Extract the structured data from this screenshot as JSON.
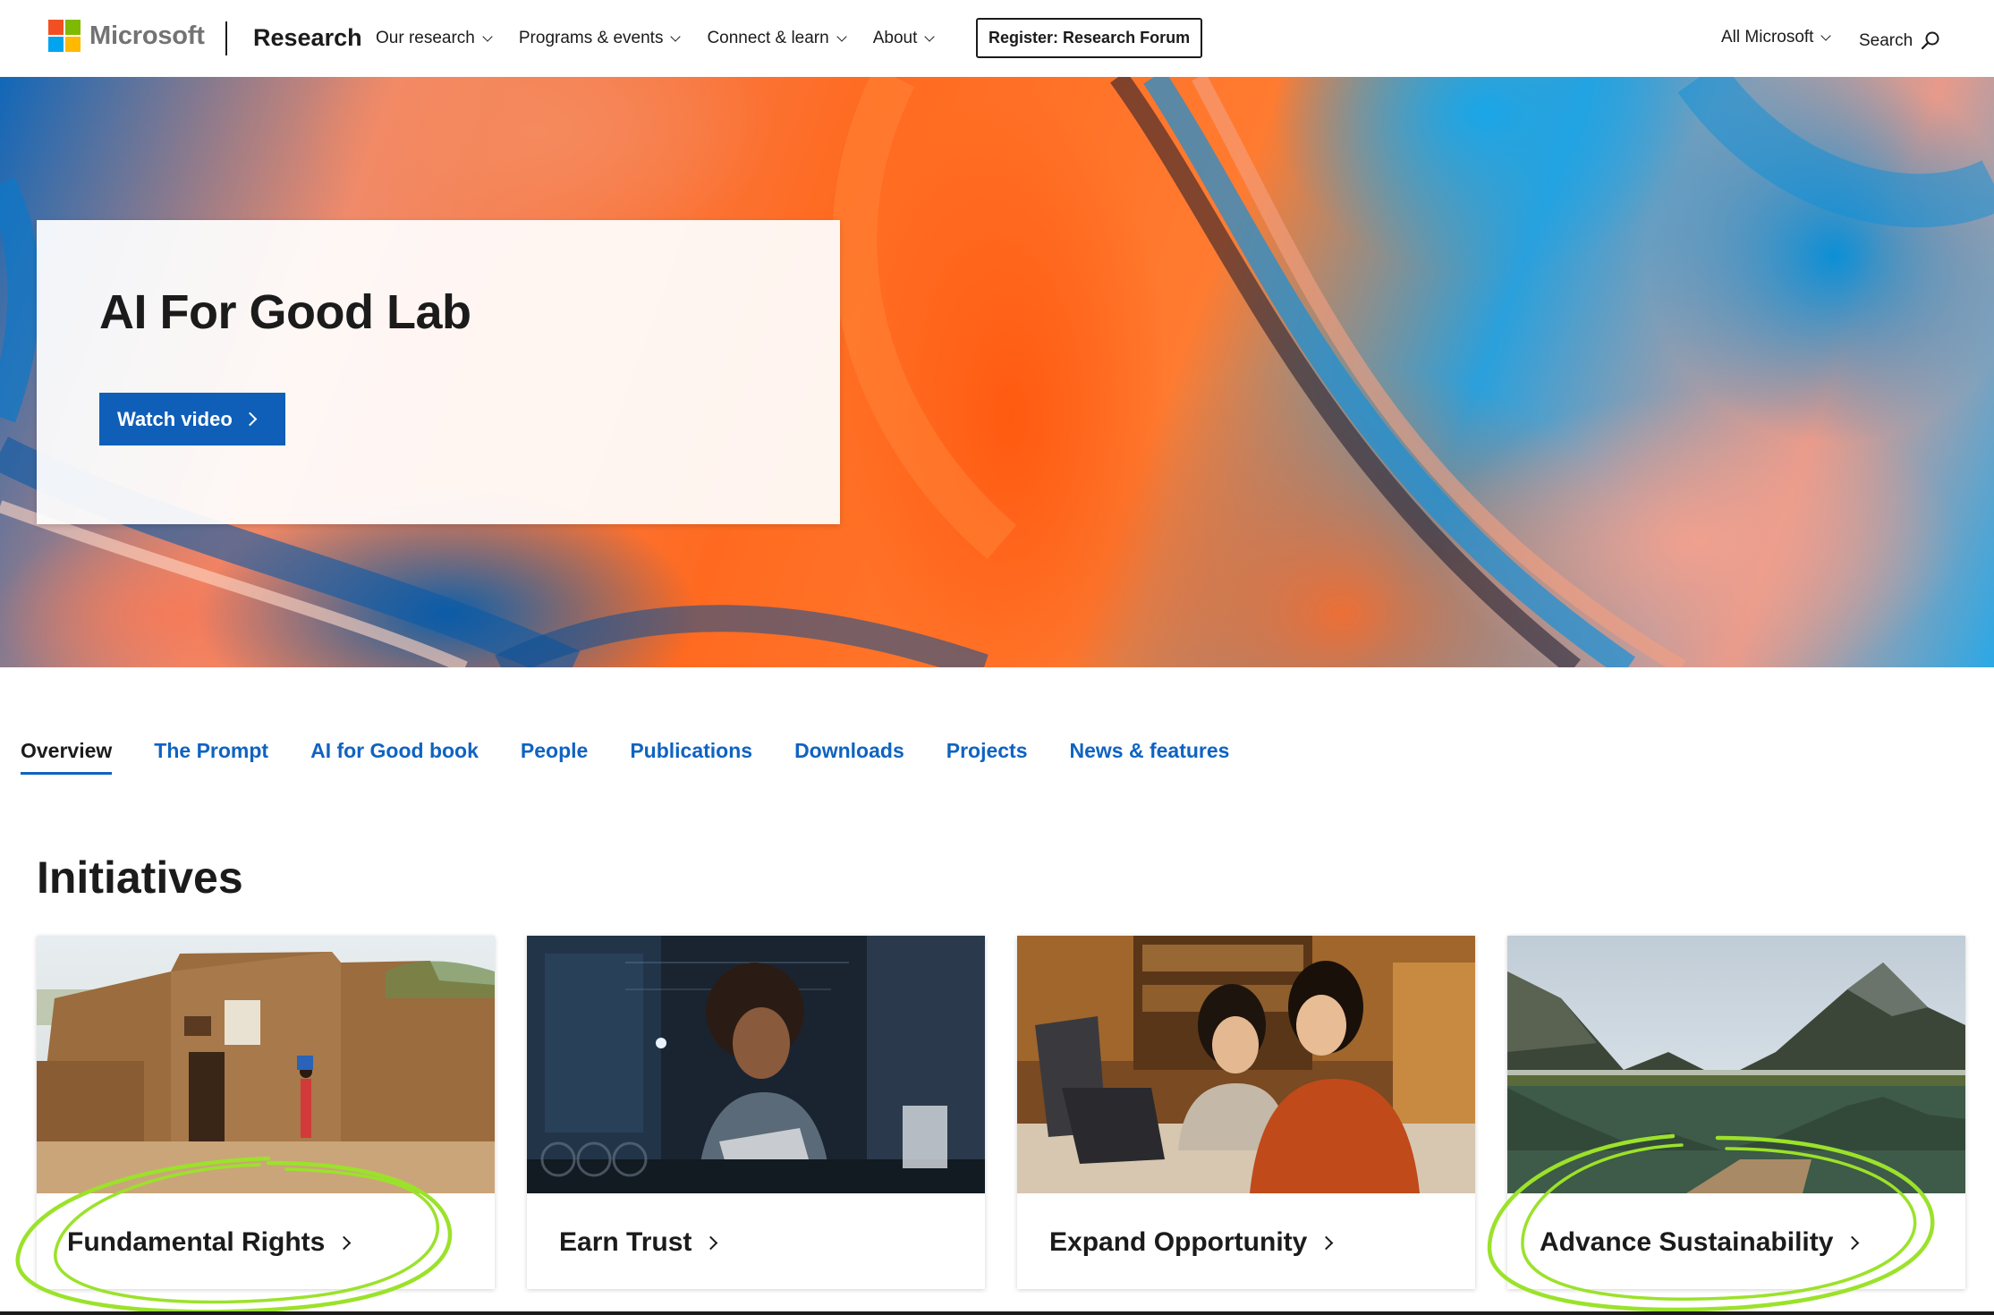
{
  "header": {
    "brand": "Microsoft",
    "section": "Research",
    "nav": [
      {
        "label": "Our research"
      },
      {
        "label": "Programs & events"
      },
      {
        "label": "Connect & learn"
      },
      {
        "label": "About"
      }
    ],
    "register_label": "Register: Research Forum",
    "all_microsoft_label": "All Microsoft",
    "search_label": "Search"
  },
  "logo_colors": [
    "#f25022",
    "#7fba00",
    "#00a4ef",
    "#ffb900"
  ],
  "hero": {
    "title": "AI For Good Lab",
    "button_label": "Watch video"
  },
  "tabs": [
    {
      "label": "Overview",
      "active": true
    },
    {
      "label": "The Prompt"
    },
    {
      "label": "AI for Good book"
    },
    {
      "label": "People"
    },
    {
      "label": "Publications"
    },
    {
      "label": "Downloads"
    },
    {
      "label": "Projects"
    },
    {
      "label": "News & features"
    }
  ],
  "initiatives": {
    "title": "Initiatives",
    "cards": [
      {
        "label": "Fundamental Rights",
        "image": "mud-brick-building-photo"
      },
      {
        "label": "Earn Trust",
        "image": "woman-with-tablet-photo"
      },
      {
        "label": "Expand Opportunity",
        "image": "two-women-at-laptop-photo"
      },
      {
        "label": "Advance Sustainability",
        "image": "mountain-lake-photo"
      }
    ]
  },
  "colors": {
    "accent_blue": "#0f63c2",
    "button_blue": "#0f5fb8",
    "annotation_green": "#9be22a"
  }
}
